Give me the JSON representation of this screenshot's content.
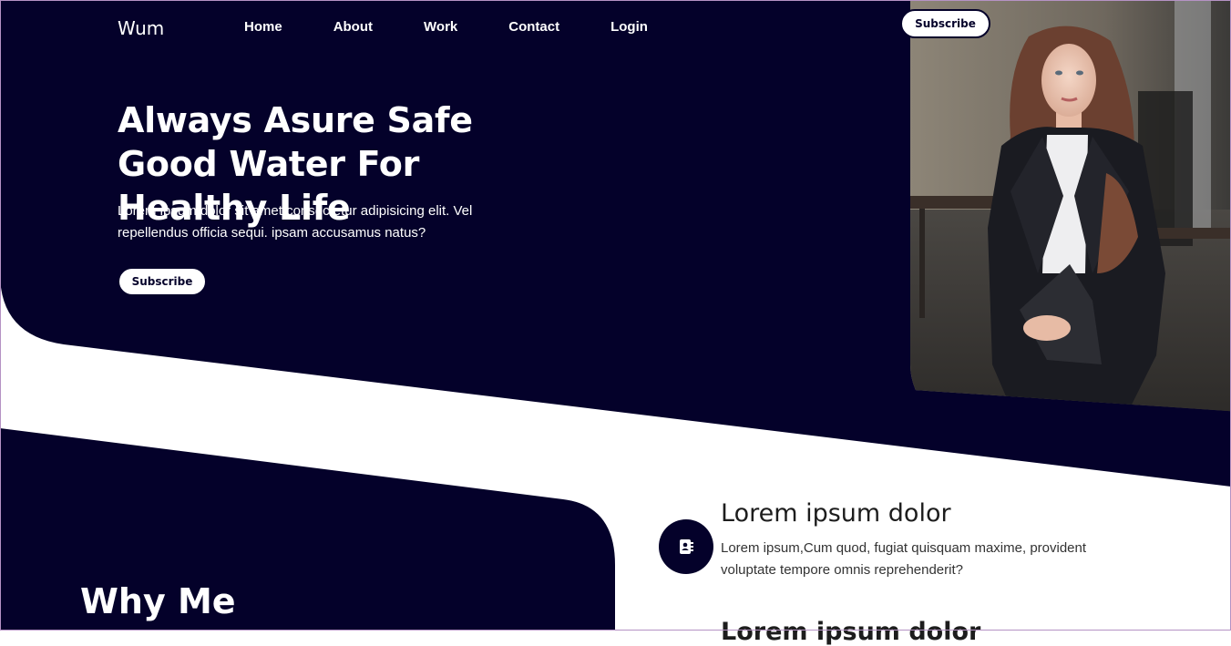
{
  "brand": "Wum",
  "nav": {
    "links": [
      "Home",
      "About",
      "Work",
      "Contact",
      "Login"
    ],
    "subscribe_label": "Subscribe"
  },
  "hero": {
    "title": "Always Asure Safe Good Water For Healthy Life",
    "text": "Lorem ipsum dolor sit amet consectetur adipisicing elit. Vel repellendus officia sequi. ipsam accusamus natus?",
    "button_label": "Subscribe"
  },
  "why": {
    "title": "Why Me"
  },
  "features": [
    {
      "icon": "contact-book-icon",
      "title": "Lorem ipsum dolor",
      "text": "Lorem ipsum,Cum quod, fugiat quisquam maxime, provident voluptate tempore omnis reprehenderit?"
    },
    {
      "title": "Lorem ipsum dolor"
    }
  ],
  "colors": {
    "navy": "#04012a",
    "white": "#ffffff"
  }
}
